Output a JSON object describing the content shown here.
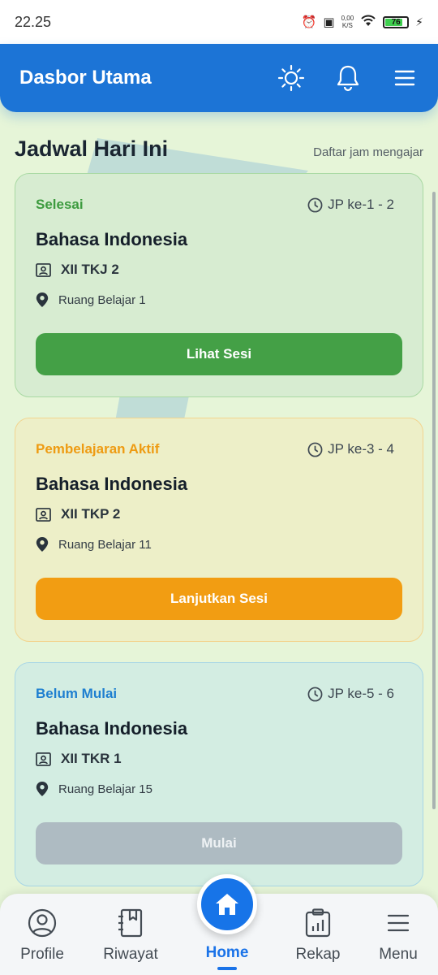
{
  "status_bar": {
    "time": "22.25",
    "net_speed_top": "0,00",
    "net_speed_unit": "K/S",
    "battery": "76"
  },
  "header": {
    "title": "Dasbor Utama",
    "icons": [
      "sun-icon",
      "bell-icon",
      "hamburger-menu-icon"
    ]
  },
  "section": {
    "title": "Jadwal Hari Ini",
    "link": "Daftar jam mengajar"
  },
  "cards": [
    {
      "status": "Selesai",
      "jp": "JP ke-1 - 2",
      "subject": "Bahasa Indonesia",
      "class": "XII TKJ 2",
      "room": "Ruang Belajar 1",
      "button": "Lihat Sesi",
      "accent": "#44a046"
    },
    {
      "status": "Pembelajaran Aktif",
      "jp": "JP ke-3 - 4",
      "subject": "Bahasa Indonesia",
      "class": "XII TKP 2",
      "room": "Ruang Belajar 11",
      "button": "Lanjutkan Sesi",
      "accent": "#f29d12"
    },
    {
      "status": "Belum Mulai",
      "jp": "JP ke-5 - 6",
      "subject": "Bahasa Indonesia",
      "class": "XII TKR 1",
      "room": "Ruang Belajar 15",
      "button": "Mulai",
      "accent": "#1e7fd0"
    }
  ],
  "bottom_nav": {
    "items": [
      {
        "label": "Profile",
        "icon": "profile-icon"
      },
      {
        "label": "Riwayat",
        "icon": "book-icon"
      },
      {
        "label": "Home",
        "icon": "home-icon"
      },
      {
        "label": "Rekap",
        "icon": "clipboard-chart-icon"
      },
      {
        "label": "Menu",
        "icon": "menu-icon"
      }
    ],
    "active": "Home"
  }
}
